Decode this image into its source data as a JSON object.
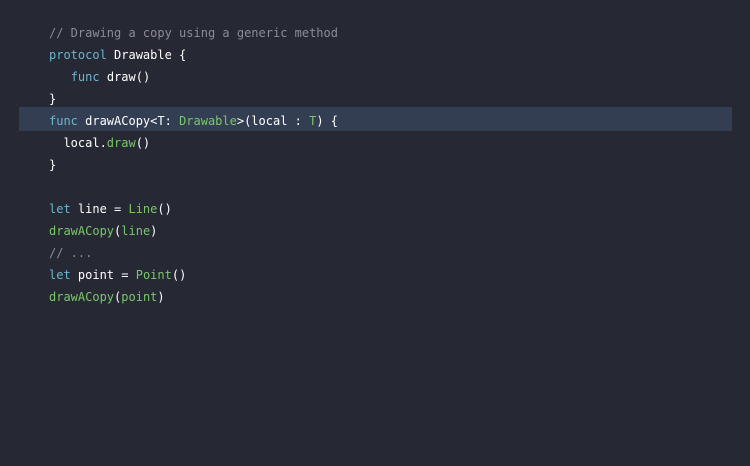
{
  "editor": {
    "lines": [
      [
        {
          "t": "// Drawing a copy using a generic method",
          "c": "comment"
        }
      ],
      [
        {
          "t": "protocol",
          "c": "keyword"
        },
        {
          "t": " Drawable {",
          "c": "plain"
        }
      ],
      [
        {
          "t": "   ",
          "c": "plain"
        },
        {
          "t": "func",
          "c": "keyword"
        },
        {
          "t": " draw()",
          "c": "plain"
        }
      ],
      [
        {
          "t": "}",
          "c": "plain"
        }
      ],
      [
        {
          "t": "func",
          "c": "keyword"
        },
        {
          "t": " drawACopy<T: ",
          "c": "plain"
        },
        {
          "t": "Drawable",
          "c": "type"
        },
        {
          "t": ">(local : ",
          "c": "plain"
        },
        {
          "t": "T",
          "c": "type"
        },
        {
          "t": ") {",
          "c": "plain"
        }
      ],
      [
        {
          "t": "  local.",
          "c": "plain"
        },
        {
          "t": "draw",
          "c": "type"
        },
        {
          "t": "()",
          "c": "plain"
        }
      ],
      [
        {
          "t": "}",
          "c": "plain"
        }
      ],
      [],
      [
        {
          "t": "let",
          "c": "keyword"
        },
        {
          "t": " line = ",
          "c": "plain"
        },
        {
          "t": "Line",
          "c": "type"
        },
        {
          "t": "()",
          "c": "plain"
        }
      ],
      [
        {
          "t": "drawACopy",
          "c": "type"
        },
        {
          "t": "(",
          "c": "plain"
        },
        {
          "t": "line",
          "c": "type"
        },
        {
          "t": ")",
          "c": "plain"
        }
      ],
      [
        {
          "t": "// ...",
          "c": "comment"
        }
      ],
      [
        {
          "t": "let",
          "c": "keyword"
        },
        {
          "t": " point = ",
          "c": "plain"
        },
        {
          "t": "Point",
          "c": "type"
        },
        {
          "t": "()",
          "c": "plain"
        }
      ],
      [
        {
          "t": "drawACopy",
          "c": "type"
        },
        {
          "t": "(",
          "c": "plain"
        },
        {
          "t": "point",
          "c": "type"
        },
        {
          "t": ")",
          "c": "plain"
        }
      ]
    ],
    "highlighted_line": 4,
    "colors": {
      "background": "#262833",
      "highlight": "#343e52",
      "comment": "#8b8c96",
      "keyword": "#6bb5ce",
      "type": "#79c76a",
      "plain": "#ffffff"
    }
  }
}
